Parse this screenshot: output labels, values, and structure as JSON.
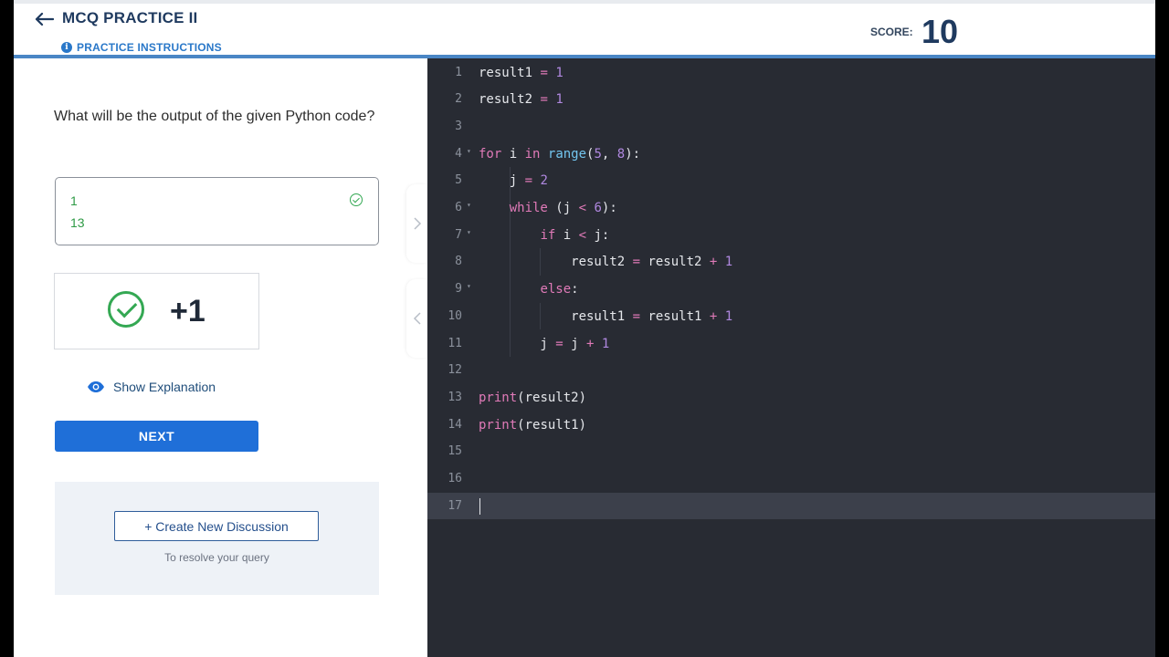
{
  "header": {
    "title": "MCQ PRACTICE II",
    "instructions_label": "PRACTICE INSTRUCTIONS",
    "score_label": "SCORE:",
    "score_value": "10"
  },
  "question": {
    "text": "What will be the output of the given Python code?",
    "answer_line1": "1",
    "answer_line2": "13"
  },
  "result": {
    "points": "+1"
  },
  "actions": {
    "show_explanation": "Show Explanation",
    "next": "NEXT",
    "create_discussion": "+ Create New Discussion",
    "discussion_sub": "To resolve your query"
  },
  "colors": {
    "accent": "#1f6fd8",
    "correct": "#34a853",
    "editor_bg": "#282b33"
  },
  "icons": [
    "back-arrow-icon",
    "info-icon",
    "check-circle-icon",
    "eye-icon",
    "chevron-right-icon",
    "chevron-left-icon"
  ],
  "editor": {
    "active_line": 17,
    "lines": [
      {
        "n": "1",
        "html": "result1 <span class=\"o\">=</span> <span class=\"n\">1</span>"
      },
      {
        "n": "2",
        "html": "result2 <span class=\"o\">=</span> <span class=\"n\">1</span>"
      },
      {
        "n": "3",
        "html": ""
      },
      {
        "n": "4",
        "fold": true,
        "html": "<span class=\"k\">for</span> i <span class=\"k\">in</span> <span class=\"f\">range</span>(<span class=\"n\">5</span>, <span class=\"n\">8</span>):"
      },
      {
        "n": "5",
        "html": "    j <span class=\"o\">=</span> <span class=\"n\">2</span>"
      },
      {
        "n": "6",
        "fold": true,
        "html": "    <span class=\"k\">while</span> (j <span class=\"o\">&lt;</span> <span class=\"n\">6</span>):"
      },
      {
        "n": "7",
        "fold": true,
        "html": "        <span class=\"k\">if</span> i <span class=\"o\">&lt;</span> j:"
      },
      {
        "n": "8",
        "html": "            result2 <span class=\"o\">=</span> result2 <span class=\"o\">+</span> <span class=\"n\">1</span>"
      },
      {
        "n": "9",
        "fold": true,
        "html": "        <span class=\"k\">else</span>:"
      },
      {
        "n": "10",
        "html": "            result1 <span class=\"o\">=</span> result1 <span class=\"o\">+</span> <span class=\"n\">1</span>"
      },
      {
        "n": "11",
        "html": "        j <span class=\"o\">=</span> j <span class=\"o\">+</span> <span class=\"n\">1</span>"
      },
      {
        "n": "12",
        "html": ""
      },
      {
        "n": "13",
        "html": "<span class=\"k\">print</span>(result2)"
      },
      {
        "n": "14",
        "html": "<span class=\"k\">print</span>(result1)"
      },
      {
        "n": "15",
        "html": ""
      },
      {
        "n": "16",
        "html": ""
      },
      {
        "n": "17",
        "html": ""
      }
    ]
  }
}
